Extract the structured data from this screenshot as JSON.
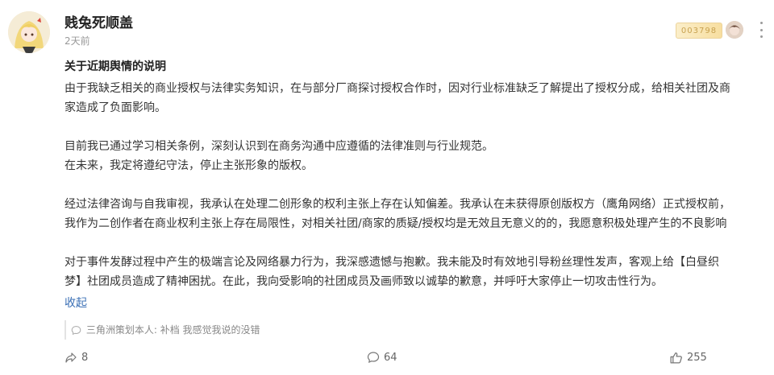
{
  "post": {
    "username": "贱兔死顺盖",
    "time": "2天前",
    "fan_badge_number": "003798",
    "title": "关于近期舆情的说明",
    "paragraphs": [
      {
        "lines": [
          "由于我缺乏相关的商业授权与法律实务知识，在与部分厂商探讨授权合作时，因对行业标准缺乏了解提出了授权分成，给相关社团及商",
          "家造成了负面影响。"
        ]
      },
      {
        "lines": [
          "目前我已通过学习相关条例，深刻认识到在商务沟通中应遵循的法律准则与行业规范。",
          "在未来，我定将遵纪守法，停止主张形象的版权。"
        ]
      },
      {
        "lines": [
          "经过法律咨询与自我审视，我承认在处理二创形象的权利主张上存在认知偏差。我承认在未获得原创版权方（鹰角网络）正式授权前，",
          "我作为二创作者在商业权利主张上存在局限性，对相关社团/商家的质疑/授权均是无效且无意义的的，我愿意积极处理产生的不良影响"
        ]
      },
      {
        "lines": [
          "对于事件发酵过程中产生的极端言论及网络暴力行为，我深感遗憾与抱歉。我未能及时有效地引导粉丝理性发声，客观上给【白昼织",
          "梦】社团成员造成了精神困扰。在此，我向受影响的社团成员及画师致以诚挚的歉意，并呼吁大家停止一切攻击性行为。"
        ]
      }
    ],
    "collapse_label": "收起",
    "comment_preview": {
      "author": "三角洲策划本人:",
      "text": " 补档 我感觉我说的没错"
    },
    "actions": {
      "share_count": "8",
      "comment_count": "64",
      "like_count": "255"
    }
  },
  "icons": [
    "avatar",
    "fan-badge",
    "more-icon",
    "comment-icon",
    "share-icon",
    "like-icon"
  ],
  "colors": {
    "link": "#3a6fb5",
    "badge_gold": "#c8a250",
    "muted_text": "#999999"
  }
}
